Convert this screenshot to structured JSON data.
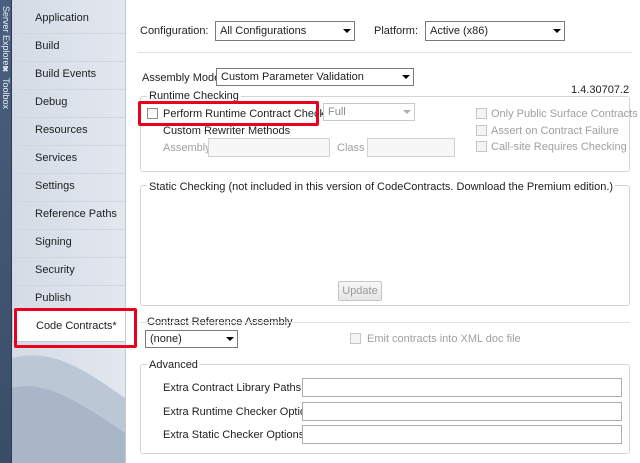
{
  "toolstrip": {
    "labels": [
      "Server Explorer",
      "Toolbox"
    ]
  },
  "sidebar": {
    "items": [
      {
        "label": "Application"
      },
      {
        "label": "Build"
      },
      {
        "label": "Build Events"
      },
      {
        "label": "Debug"
      },
      {
        "label": "Resources"
      },
      {
        "label": "Services"
      },
      {
        "label": "Settings"
      },
      {
        "label": "Reference Paths"
      },
      {
        "label": "Signing"
      },
      {
        "label": "Security"
      },
      {
        "label": "Publish"
      },
      {
        "label": "Code Contracts*",
        "active": true
      }
    ]
  },
  "header": {
    "configuration_label": "Configuration:",
    "configuration_value": "All Configurations",
    "platform_label": "Platform:",
    "platform_value": "Active (x86)"
  },
  "assembly_mode": {
    "label": "Assembly Mode:",
    "value": "Custom Parameter Validation",
    "version": "1.4.30707.2"
  },
  "runtime_checking": {
    "title": "Runtime Checking",
    "perform_label": "Perform Runtime Contract Checking",
    "level_value": "Full",
    "custom_rewriter_title": "Custom Rewriter Methods",
    "assembly_label": "Assembly",
    "class_label": "Class",
    "only_public_label": "Only Public Surface Contracts",
    "assert_on_failure_label": "Assert on Contract Failure",
    "call_site_label": "Call-site Requires Checking"
  },
  "static_checking": {
    "title": "Static Checking (not included in this version of CodeContracts. Download the Premium edition.)",
    "update_button": "Update"
  },
  "contract_reference": {
    "title": "Contract Reference Assembly",
    "value": "(none)",
    "emit_xml_label": "Emit contracts into XML doc file"
  },
  "advanced": {
    "title": "Advanced",
    "fields": [
      {
        "label": "Extra Contract Library Paths",
        "value": ""
      },
      {
        "label": "Extra Runtime Checker Options",
        "value": ""
      },
      {
        "label": "Extra Static Checker Options",
        "value": ""
      }
    ]
  },
  "colors": {
    "highlight": "#e8001c",
    "sidebar": "#d4dbe6"
  }
}
